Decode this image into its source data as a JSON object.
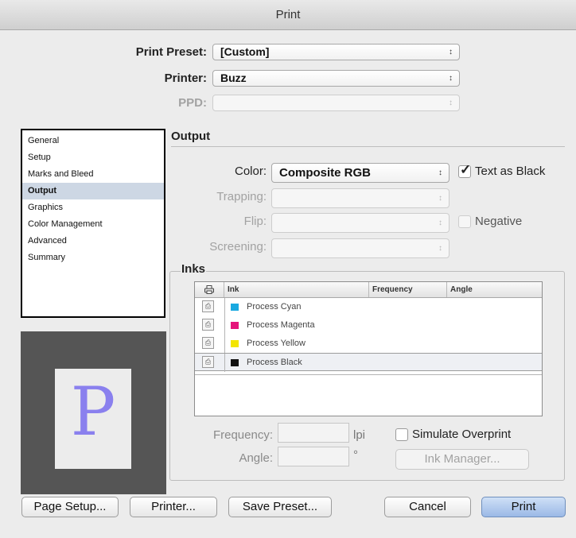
{
  "window": {
    "title": "Print"
  },
  "top": {
    "print_preset_label": "Print Preset:",
    "print_preset_value": "[Custom]",
    "printer_label": "Printer:",
    "printer_value": "Buzz",
    "ppd_label": "PPD:",
    "ppd_value": ""
  },
  "sidebar": {
    "items": [
      "General",
      "Setup",
      "Marks and Bleed",
      "Output",
      "Graphics",
      "Color Management",
      "Advanced",
      "Summary"
    ],
    "selected": "Output"
  },
  "preview": {
    "glyph": "P"
  },
  "output": {
    "section_title": "Output",
    "color_label": "Color:",
    "color_value": "Composite RGB",
    "text_as_black_label": "Text as Black",
    "text_as_black_checked": true,
    "trapping_label": "Trapping:",
    "flip_label": "Flip:",
    "negative_label": "Negative",
    "negative_checked": false,
    "screening_label": "Screening:"
  },
  "inks": {
    "group_label": "Inks",
    "columns": {
      "print": "print-icon",
      "ink": "Ink",
      "frequency": "Frequency",
      "angle": "Angle"
    },
    "rows": [
      {
        "name": "Process Cyan",
        "color": "#1aa9e0"
      },
      {
        "name": "Process Magenta",
        "color": "#e5157b"
      },
      {
        "name": "Process Yellow",
        "color": "#f3e500"
      },
      {
        "name": "Process Black",
        "color": "#111111"
      }
    ],
    "frequency_label": "Frequency:",
    "frequency_unit": "lpi",
    "angle_label": "Angle:",
    "angle_unit": "°",
    "simulate_overprint_label": "Simulate Overprint",
    "simulate_overprint_checked": false,
    "ink_manager_label": "Ink Manager..."
  },
  "buttons": {
    "page_setup": "Page Setup...",
    "printer": "Printer...",
    "save_preset": "Save Preset...",
    "cancel": "Cancel",
    "print": "Print"
  }
}
